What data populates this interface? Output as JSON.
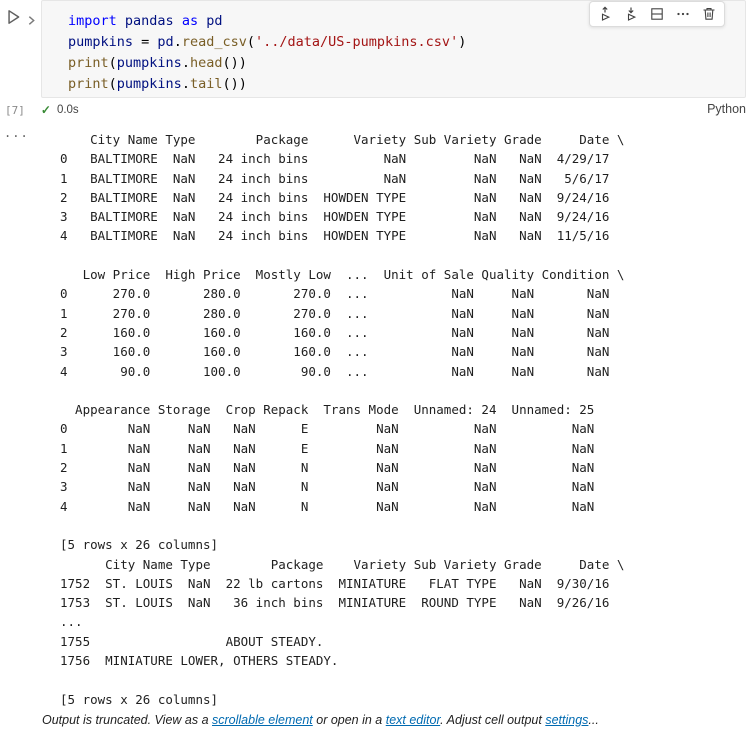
{
  "colors": {
    "kw": "#0000ff",
    "var": "#001080",
    "func": "#795e26",
    "str": "#a31515",
    "plain": "#000000",
    "check": "#388a34",
    "muted": "#616161",
    "link": "#006ab1",
    "output-text": "#1f1f1f"
  },
  "cell": {
    "gutter_icons": [
      "play-icon",
      "chevron-right-icon"
    ],
    "toolbar": {
      "icons": [
        "run-above-icon",
        "run-below-icon",
        "split-cell-icon",
        "more-actions-icon",
        "delete-icon"
      ]
    },
    "code": {
      "lines": [
        [
          {
            "c": "kw",
            "t": "import"
          },
          {
            "c": "plain",
            "t": " "
          },
          {
            "c": "var",
            "t": "pandas"
          },
          {
            "c": "plain",
            "t": " "
          },
          {
            "c": "kw",
            "t": "as"
          },
          {
            "c": "plain",
            "t": " "
          },
          {
            "c": "var",
            "t": "pd"
          }
        ],
        [
          {
            "c": "var",
            "t": "pumpkins"
          },
          {
            "c": "plain",
            "t": " = "
          },
          {
            "c": "var",
            "t": "pd"
          },
          {
            "c": "plain",
            "t": "."
          },
          {
            "c": "func",
            "t": "read_csv"
          },
          {
            "c": "plain",
            "t": "("
          },
          {
            "c": "str",
            "t": "'../data/US-pumpkins.csv'"
          },
          {
            "c": "plain",
            "t": ")"
          }
        ],
        [
          {
            "c": "func",
            "t": "print"
          },
          {
            "c": "plain",
            "t": "("
          },
          {
            "c": "var",
            "t": "pumpkins"
          },
          {
            "c": "plain",
            "t": "."
          },
          {
            "c": "func",
            "t": "head"
          },
          {
            "c": "plain",
            "t": "())"
          }
        ],
        [
          {
            "c": "func",
            "t": "print"
          },
          {
            "c": "plain",
            "t": "("
          },
          {
            "c": "var",
            "t": "pumpkins"
          },
          {
            "c": "plain",
            "t": "."
          },
          {
            "c": "func",
            "t": "tail"
          },
          {
            "c": "plain",
            "t": "())"
          }
        ]
      ]
    },
    "execution": {
      "count": "[7]",
      "check": "✓",
      "duration": "0.0s",
      "language": "Python"
    }
  },
  "output": {
    "more_button": "...",
    "lines": [
      "    City Name Type        Package      Variety Sub Variety Grade     Date \\",
      "0   BALTIMORE  NaN   24 inch bins          NaN         NaN   NaN  4/29/17",
      "1   BALTIMORE  NaN   24 inch bins          NaN         NaN   NaN   5/6/17",
      "2   BALTIMORE  NaN   24 inch bins  HOWDEN TYPE         NaN   NaN  9/24/16",
      "3   BALTIMORE  NaN   24 inch bins  HOWDEN TYPE         NaN   NaN  9/24/16",
      "4   BALTIMORE  NaN   24 inch bins  HOWDEN TYPE         NaN   NaN  11/5/16",
      "",
      "   Low Price  High Price  Mostly Low  ...  Unit of Sale Quality Condition \\",
      "0      270.0       280.0       270.0  ...           NaN     NaN       NaN",
      "1      270.0       280.0       270.0  ...           NaN     NaN       NaN",
      "2      160.0       160.0       160.0  ...           NaN     NaN       NaN",
      "3      160.0       160.0       160.0  ...           NaN     NaN       NaN",
      "4       90.0       100.0        90.0  ...           NaN     NaN       NaN",
      "",
      "  Appearance Storage  Crop Repack  Trans Mode  Unnamed: 24  Unnamed: 25",
      "0        NaN     NaN   NaN      E         NaN          NaN          NaN",
      "1        NaN     NaN   NaN      E         NaN          NaN          NaN",
      "2        NaN     NaN   NaN      N         NaN          NaN          NaN",
      "3        NaN     NaN   NaN      N         NaN          NaN          NaN",
      "4        NaN     NaN   NaN      N         NaN          NaN          NaN",
      "",
      "[5 rows x 26 columns]",
      "      City Name Type        Package    Variety Sub Variety Grade     Date \\",
      "1752  ST. LOUIS  NaN  22 lb cartons  MINIATURE   FLAT TYPE   NaN  9/30/16",
      "1753  ST. LOUIS  NaN   36 inch bins  MINIATURE  ROUND TYPE   NaN  9/26/16",
      "...",
      "1755                  ABOUT STEADY.",
      "1756  MINIATURE LOWER, OTHERS STEADY.",
      "",
      "[5 rows x 26 columns]"
    ]
  },
  "footer": {
    "segments": [
      {
        "t": "Output is truncated. View as a "
      },
      {
        "t": "scrollable element",
        "link": true
      },
      {
        "t": " or open in a "
      },
      {
        "t": "text editor",
        "link": true
      },
      {
        "t": ". Adjust cell output "
      },
      {
        "t": "settings",
        "link": true
      },
      {
        "t": "..."
      }
    ]
  }
}
